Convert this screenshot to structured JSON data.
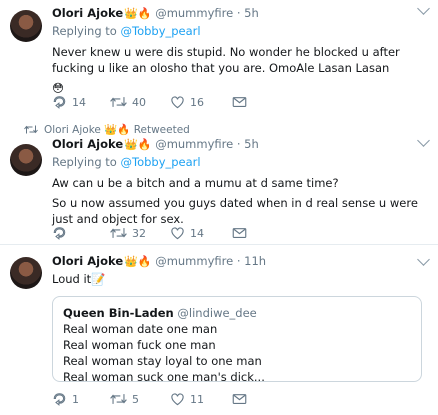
{
  "tweets": [
    {
      "name": "Olori Ajoke",
      "name_emoji": "👑🔥",
      "handle": "@mummyfire",
      "dot": "·",
      "time": "5h",
      "replying_prefix": "Replying to",
      "replying_handle": "@Tobby_pearl",
      "lines": [
        "Never knew u were dis stupid. No wonder he blocked u after fucking u like an olosho that you are. OmoAle Lasan Lasan",
        "😳"
      ],
      "replies": "14",
      "retweets": "40",
      "likes": "16"
    },
    {
      "retweeted_label": "Olori Ajoke 👑🔥 Retweeted",
      "name": "Olori Ajoke",
      "name_emoji": "👑🔥",
      "handle": "@mummyfire",
      "dot": "·",
      "time": "5h",
      "replying_prefix": "Replying to",
      "replying_handle": "@Tobby_pearl",
      "lines": [
        "Aw can u be a bitch and a mumu at d same time?",
        "So u now assumed you guys dated when in d real sense u were just and object for sex."
      ],
      "replies": "",
      "retweets": "32",
      "likes": "14"
    },
    {
      "name": "Olori Ajoke",
      "name_emoji": "👑🔥",
      "handle": "@mummyfire",
      "dot": "·",
      "time": "11h",
      "lines": [
        "Loud it📝"
      ],
      "quote": {
        "name": "Queen Bin-Laden",
        "handle": "@lindiwe_dee",
        "lines": [
          "Real woman date one man",
          "Real woman fuck one man",
          "Real woman stay loyal to one man",
          "Real woman suck one man's dick..."
        ]
      },
      "replies": "1",
      "retweets": "5",
      "likes": "11"
    }
  ],
  "icons": {
    "reply": "reply-icon",
    "retweet": "retweet-icon",
    "like": "heart-icon",
    "dm": "envelope-icon",
    "more": "chevron-down-icon"
  },
  "colors": {
    "link": "#1da1f2",
    "muted": "#657786",
    "border": "#e6ecf0"
  }
}
